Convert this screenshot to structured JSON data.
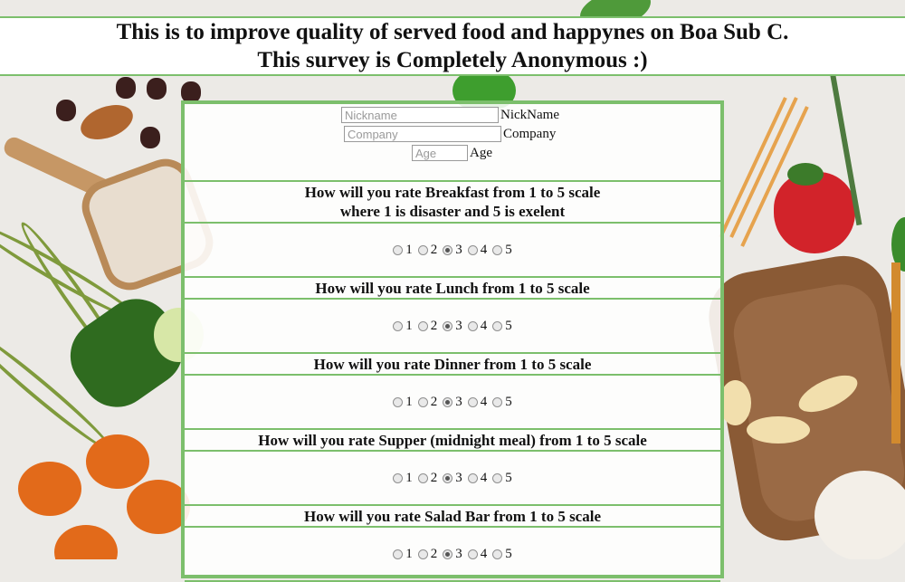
{
  "header": {
    "line1": "This is to improve quality of served food and happynes on Boa Sub C.",
    "line2": "This survey is Completely Anonymous :)"
  },
  "identity": {
    "nickname": {
      "placeholder": "Nickname",
      "label": "NickName",
      "value": ""
    },
    "company": {
      "placeholder": "Company",
      "label": "Company",
      "value": ""
    },
    "age": {
      "placeholder": "Age",
      "label": "Age",
      "value": ""
    }
  },
  "questions": [
    {
      "title_line1": "How will you rate Breakfast from 1 to 5 scale",
      "title_line2": "where 1 is disaster and 5 is exelent",
      "options": [
        "1",
        "2",
        "3",
        "4",
        "5"
      ],
      "selected": "3"
    },
    {
      "title_line1": "How will you rate Lunch from 1 to 5 scale",
      "options": [
        "1",
        "2",
        "3",
        "4",
        "5"
      ],
      "selected": "3"
    },
    {
      "title_line1": "How will you rate Dinner from 1 to 5 scale",
      "options": [
        "1",
        "2",
        "3",
        "4",
        "5"
      ],
      "selected": "3"
    },
    {
      "title_line1": "How will you rate Supper (midnight meal) from 1 to 5 scale",
      "options": [
        "1",
        "2",
        "3",
        "4",
        "5"
      ],
      "selected": "3"
    },
    {
      "title_line1": "How will you rate Salad Bar from 1 to 5 scale",
      "options": [
        "1",
        "2",
        "3",
        "4",
        "5"
      ],
      "selected": "3"
    }
  ],
  "colors": {
    "border": "#7cbf6c",
    "header_bg": "#ffffff"
  }
}
